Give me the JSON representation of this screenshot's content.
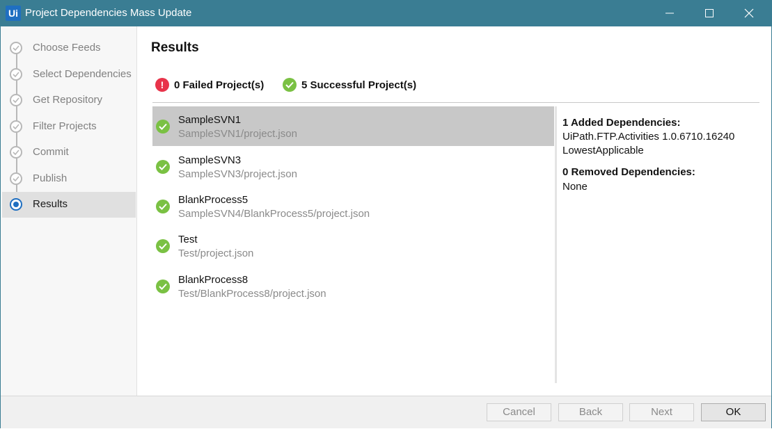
{
  "window": {
    "logo": "Ui",
    "title": "Project Dependencies Mass Update",
    "controls": [
      "minimize-icon",
      "maximize-icon",
      "close-icon"
    ]
  },
  "sidebar": {
    "steps": [
      {
        "label": "Choose Feeds",
        "state": "done"
      },
      {
        "label": "Select Dependencies",
        "state": "done"
      },
      {
        "label": "Get Repository",
        "state": "done"
      },
      {
        "label": "Filter Projects",
        "state": "done"
      },
      {
        "label": "Commit",
        "state": "done"
      },
      {
        "label": "Publish",
        "state": "done"
      },
      {
        "label": "Results",
        "state": "active"
      }
    ]
  },
  "main": {
    "title": "Results",
    "summary": {
      "failed_label": "0 Failed Project(s)",
      "failed_icon": "!",
      "success_label": "5 Successful Project(s)"
    },
    "projects": [
      {
        "name": "SampleSVN1",
        "path": "SampleSVN1/project.json",
        "selected": true
      },
      {
        "name": "SampleSVN3",
        "path": "SampleSVN3/project.json",
        "selected": false
      },
      {
        "name": "BlankProcess5",
        "path": "SampleSVN4/BlankProcess5/project.json",
        "selected": false
      },
      {
        "name": "Test",
        "path": "Test/project.json",
        "selected": false
      },
      {
        "name": "BlankProcess8",
        "path": "Test/BlankProcess8/project.json",
        "selected": false
      }
    ],
    "details": {
      "added_heading": "1 Added Dependencies:",
      "added_items": [
        "UiPath.FTP.Activities 1.0.6710.16240",
        "LowestApplicable"
      ],
      "removed_heading": "0 Removed Dependencies:",
      "removed_value": "None"
    }
  },
  "footer": {
    "cancel": "Cancel",
    "back": "Back",
    "next": "Next",
    "ok": "OK"
  },
  "colors": {
    "titlebar": "#3a7d93",
    "accent": "#1f6fc1",
    "success": "#7ac143",
    "failed": "#e8334a",
    "selected_row": "#c8c8c8"
  }
}
